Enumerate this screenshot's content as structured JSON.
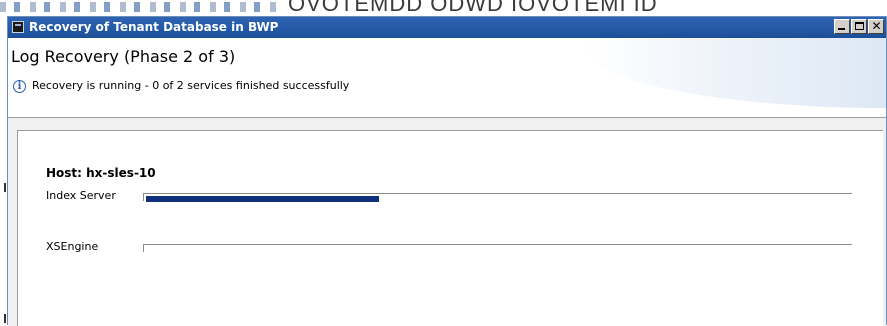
{
  "window": {
    "title": "Recovery of Tenant Database in BWP"
  },
  "header": {
    "title": "Log Recovery (Phase 2 of 3)",
    "status_text": "Recovery is running - 0 of 2 services finished successfully"
  },
  "host": {
    "label": "Host: hx-sles-10",
    "services": [
      {
        "name": "Index Server",
        "progress": 0.33
      },
      {
        "name": "XSEngine",
        "progress": 0
      }
    ]
  },
  "background": {
    "partial_text": "OVOTEMDD ODWD IOVOTEMI ID"
  },
  "colors": {
    "titlebar": "#245aa8",
    "progress_fill": "#10307c",
    "info_icon": "#2a5db0"
  },
  "icons": {
    "app": "app-window-icon",
    "info": "info-icon",
    "minimize": "minimize-icon",
    "maximize": "maximize-icon",
    "close": "close-icon"
  }
}
